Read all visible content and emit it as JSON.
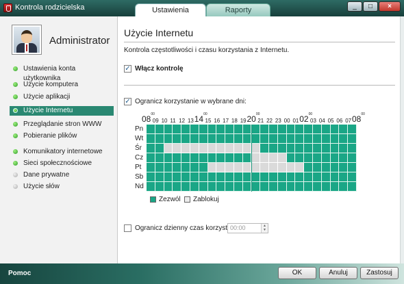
{
  "window": {
    "title": "Kontrola rodzicielska",
    "controls": [
      "_",
      "□",
      "×"
    ]
  },
  "tabs": [
    {
      "label": "Ustawienia",
      "active": true
    },
    {
      "label": "Raporty",
      "active": false
    }
  ],
  "user": {
    "name": "Administrator"
  },
  "sidebar": {
    "items": [
      {
        "label": "Ustawienia konta użytkownika",
        "status": "green"
      },
      {
        "label": "Użycie komputera",
        "status": "green"
      },
      {
        "label": "Użycie aplikacji",
        "status": "green"
      },
      {
        "label": "Użycie Internetu",
        "status": "green",
        "active": true
      },
      {
        "label": "Przeglądanie stron WWW",
        "status": "green"
      },
      {
        "label": "Pobieranie plików",
        "status": "green"
      },
      {
        "label": "Komunikatory internetowe",
        "status": "green"
      },
      {
        "label": "Sieci społecznościowe",
        "status": "green"
      },
      {
        "label": "Dane prywatne",
        "status": "grey"
      },
      {
        "label": "Użycie słów",
        "status": "grey"
      }
    ]
  },
  "main": {
    "title": "Użycie Internetu",
    "description": "Kontrola częstotliwości i czasu korzystania z Internetu.",
    "enable_checkbox": {
      "label": "Włącz kontrolę",
      "checked": true
    },
    "limit_days_checkbox": {
      "label": "Ogranicz korzystanie w wybrane dni:",
      "checked": true
    },
    "schedule": {
      "hours": [
        "08",
        "09",
        "10",
        "11",
        "12",
        "13",
        "14",
        "15",
        "16",
        "17",
        "18",
        "19",
        "20",
        "21",
        "22",
        "23",
        "00",
        "01",
        "02",
        "03",
        "04",
        "05",
        "06",
        "07",
        "08"
      ],
      "hour_minutes": "00",
      "days": [
        "Pn",
        "Wt",
        "Śr",
        "Cz",
        "Pt",
        "Sb",
        "Nd"
      ],
      "blocked": [
        [],
        [],
        [
          2,
          3,
          4,
          5,
          6,
          7,
          8,
          9,
          10,
          11,
          12
        ],
        [
          12,
          13,
          14,
          15
        ],
        [
          7,
          8,
          9,
          10,
          11,
          12,
          13,
          14,
          15,
          16,
          17
        ],
        [],
        []
      ]
    },
    "legend": {
      "allow": "Zezwól",
      "block": "Zablokuj"
    },
    "daily_limit_checkbox": {
      "label": "Ogranicz dzienny czas korzystania:",
      "checked": false
    },
    "daily_limit_value": "00:00"
  },
  "footer": {
    "help_label": "Pomoc",
    "ok_label": "OK",
    "cancel_label": "Anuluj",
    "apply_label": "Zastosuj"
  },
  "colors": {
    "allowed": "#1aa686",
    "blocked": "#dadada",
    "active_nav": "#2a8872",
    "title_bar": "#1f4f49"
  }
}
